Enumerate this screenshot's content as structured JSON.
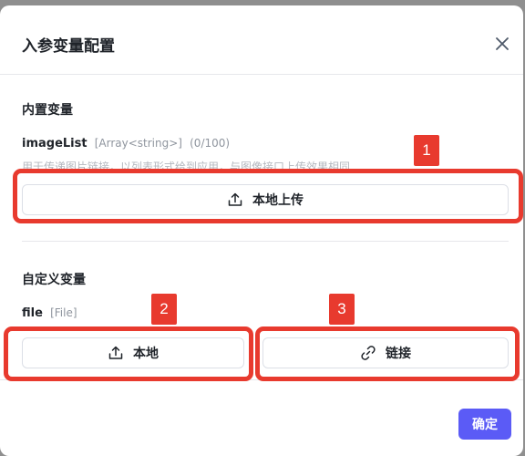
{
  "dialog": {
    "title": "入参变量配置",
    "confirm_label": "确定"
  },
  "builtin": {
    "section_title": "内置变量",
    "var_name": "imageList",
    "var_type": "[Array<string>]",
    "var_count": "(0/100)",
    "hint": "用于传递图片链接，以列表形式给到应用，与图像接口上传效果相同",
    "upload_label": "本地上传"
  },
  "custom": {
    "section_title": "自定义变量",
    "var_name": "file",
    "var_type": "[File]",
    "local_label": "本地",
    "link_label": "链接"
  },
  "annotations": {
    "badge1": "1",
    "badge2": "2",
    "badge3": "3",
    "color": "#e83a2e"
  },
  "colors": {
    "primary": "#5b5bf6",
    "muted": "#8f959e"
  }
}
